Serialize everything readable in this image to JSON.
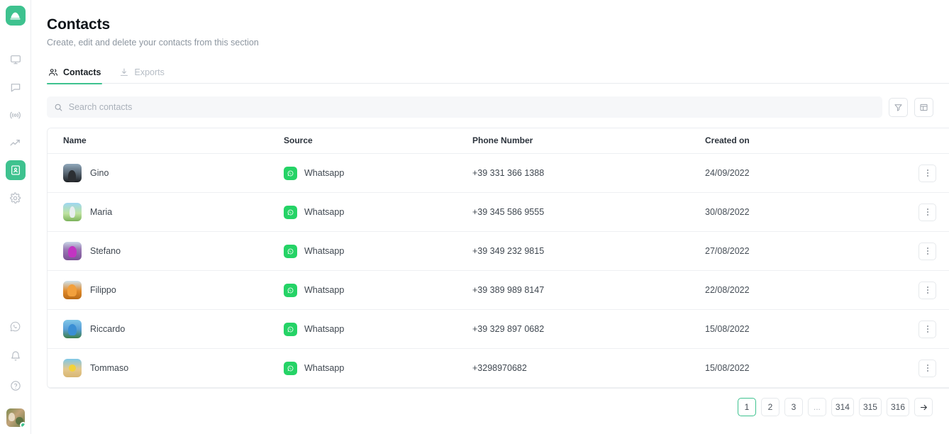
{
  "sidebar": {
    "logo_icon": "mountain-logo-icon",
    "items": [
      {
        "icon": "monitor-dashboard-icon",
        "active": false
      },
      {
        "icon": "chat-bubble-icon",
        "active": false
      },
      {
        "icon": "broadcast-icon",
        "active": false
      },
      {
        "icon": "analytics-trend-icon",
        "active": false
      },
      {
        "icon": "contacts-book-icon",
        "active": true
      },
      {
        "icon": "gear-settings-icon",
        "active": false
      }
    ],
    "bottom_items": [
      {
        "icon": "whatsapp-icon"
      },
      {
        "icon": "bell-notification-icon"
      },
      {
        "icon": "help-circle-icon"
      }
    ],
    "avatar_name": "user-avatar",
    "status": "online"
  },
  "header": {
    "title": "Contacts",
    "subtitle": "Create, edit and delete your contacts from this section"
  },
  "tabs": [
    {
      "label": "Contacts",
      "icon": "users-icon",
      "active": true
    },
    {
      "label": "Exports",
      "icon": "download-icon",
      "active": false
    }
  ],
  "search": {
    "placeholder": "Search contacts",
    "value": "",
    "icon": "search-icon"
  },
  "toolbar": {
    "filter_icon": "filter-funnel-icon",
    "columns_icon": "table-columns-icon"
  },
  "table": {
    "columns": [
      "Name",
      "Source",
      "Phone Number",
      "Created on"
    ],
    "rows": [
      {
        "name": "Gino",
        "avatar": "av-gino",
        "source": "Whatsapp",
        "source_icon": "whatsapp-icon",
        "phone": "+39 331 366 1388",
        "created": "24/09/2022"
      },
      {
        "name": "Maria",
        "avatar": "av-maria",
        "source": "Whatsapp",
        "source_icon": "whatsapp-icon",
        "phone": "+39 345 586 9555",
        "created": "30/08/2022"
      },
      {
        "name": "Stefano",
        "avatar": "av-stefano",
        "source": "Whatsapp",
        "source_icon": "whatsapp-icon",
        "phone": "+39 349 232 9815",
        "created": "27/08/2022"
      },
      {
        "name": "Filippo",
        "avatar": "av-filippo",
        "source": "Whatsapp",
        "source_icon": "whatsapp-icon",
        "phone": "+39 389 989 8147",
        "created": "22/08/2022"
      },
      {
        "name": "Riccardo",
        "avatar": "av-riccardo",
        "source": "Whatsapp",
        "source_icon": "whatsapp-icon",
        "phone": "+39 329 897 0682",
        "created": "15/08/2022"
      },
      {
        "name": "Tommaso",
        "avatar": "av-tommaso",
        "source": "Whatsapp",
        "source_icon": "whatsapp-icon",
        "phone": "+3298970682",
        "created": "15/08/2022"
      }
    ],
    "row_menu_icon": "more-vertical-icon"
  },
  "pagination": {
    "pages": [
      "1",
      "2",
      "3",
      "...",
      "314",
      "315",
      "316"
    ],
    "current": "1",
    "next_icon": "arrow-right-icon"
  },
  "colors": {
    "accent": "#3ec28f",
    "whatsapp": "#25D366",
    "text": "#3f4750",
    "muted": "#8d96a0",
    "border": "#ebedf0"
  }
}
